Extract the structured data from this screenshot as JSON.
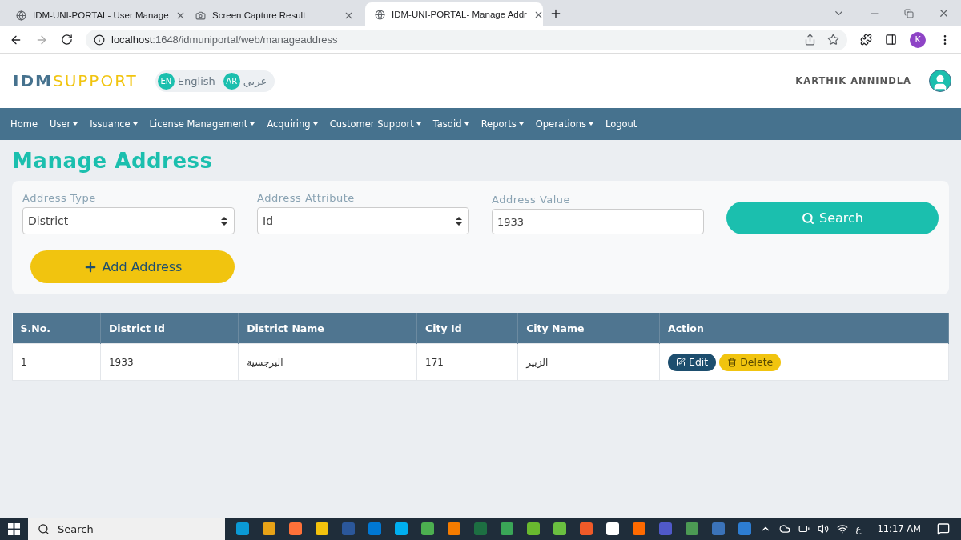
{
  "browser": {
    "tabs": [
      {
        "title": "IDM-UNI-PORTAL- User Manage",
        "kind": "page",
        "selected": false
      },
      {
        "title": "Screen Capture Result",
        "kind": "capture",
        "selected": false
      },
      {
        "title": "IDM-UNI-PORTAL- Manage Addr",
        "kind": "page",
        "selected": true
      }
    ],
    "url_host": "localhost",
    "url_rest": ":1648/idmuniportal/web/manageaddress",
    "profile_initial": "K"
  },
  "header": {
    "logo_bold": "IDM",
    "logo_light": "SUPPORT",
    "languages": [
      {
        "code": "EN",
        "label": "English"
      },
      {
        "code": "AR",
        "label": "عربي"
      }
    ],
    "user_name": "KARTHIK ANNINDLA"
  },
  "nav": [
    {
      "label": "Home",
      "has_menu": false
    },
    {
      "label": "User",
      "has_menu": true
    },
    {
      "label": "Issuance",
      "has_menu": true
    },
    {
      "label": "License Management",
      "has_menu": true
    },
    {
      "label": "Acquiring",
      "has_menu": true
    },
    {
      "label": "Customer Support",
      "has_menu": true
    },
    {
      "label": "Tasdid",
      "has_menu": true
    },
    {
      "label": "Reports",
      "has_menu": true
    },
    {
      "label": "Operations",
      "has_menu": true
    },
    {
      "label": "Logout",
      "has_menu": false
    }
  ],
  "page_title": "Manage Address",
  "filters": [
    {
      "label": "Address Type",
      "kind": "select",
      "value": "District"
    },
    {
      "label": "Address Attribute",
      "kind": "select",
      "value": "Id"
    },
    {
      "label": "Address Value",
      "kind": "input",
      "value": "1933"
    }
  ],
  "search_button": "Search",
  "add_button": "Add Address",
  "table": {
    "columns": [
      "S.No.",
      "District Id",
      "District Name",
      "City Id",
      "City Name",
      "Action"
    ],
    "rows": [
      {
        "cells": [
          "1",
          "1933",
          "البرجسية",
          "171",
          "الزبير"
        ],
        "actions": [
          {
            "label": "Edit",
            "kind": "edit"
          },
          {
            "label": "Delete",
            "kind": "delete"
          }
        ]
      }
    ]
  },
  "taskbar": {
    "search_placeholder": "Search",
    "time": "11:17 AM",
    "keyboard": "ع"
  }
}
